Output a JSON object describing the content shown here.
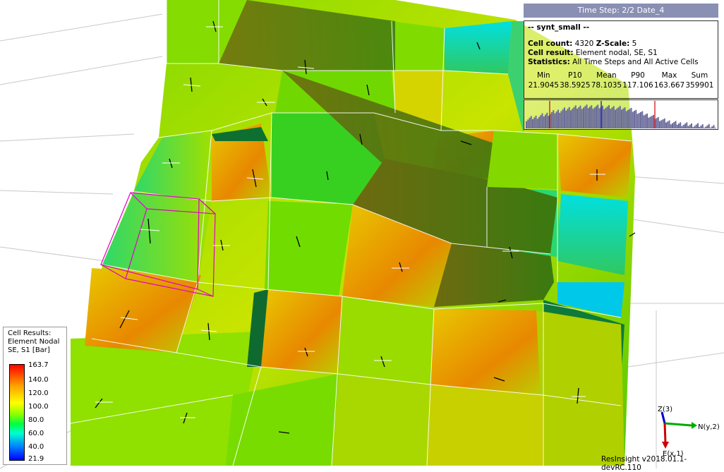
{
  "time_step": "Time Step: 2/2 Date_4",
  "info": {
    "title": "-- synt_small --",
    "cell_count_label": "Cell count:",
    "cell_count": "4320",
    "zscale_label": "Z-Scale:",
    "zscale": "5",
    "cell_result_label": "Cell result:",
    "cell_result": "Element nodal, SE, S1",
    "statistics_label": "Statistics:",
    "statistics": "All Time Steps and All Active Cells",
    "stat_headers": [
      "Min",
      "P10",
      "Mean",
      "P90",
      "Max",
      "Sum"
    ],
    "stat_values": [
      "21.9045",
      "38.5925",
      "78.1035",
      "117.106",
      "163.667",
      "359901"
    ]
  },
  "histogram": {
    "bar_color": "#6b6b9c",
    "p10_color": "#cc0000",
    "mean_color": "#0000cc",
    "p90_color": "#cc0000"
  },
  "legend": {
    "title_lines": [
      "Cell Results:",
      "Element Nodal",
      "SE, S1 [Bar]"
    ],
    "ticks": [
      "163.7",
      "140.0",
      "120.0",
      "100.0",
      "80.0",
      "60.0",
      "40.0",
      "21.9"
    ]
  },
  "axes": {
    "z_label": "Z(3)",
    "n_label": "N(y,2)",
    "e_label": "E(x,1)",
    "z_color": "#0000cc",
    "n_color": "#00aa00",
    "e_color": "#cc0000"
  },
  "version": "ResInsight v2018.01.1-devRC.110"
}
